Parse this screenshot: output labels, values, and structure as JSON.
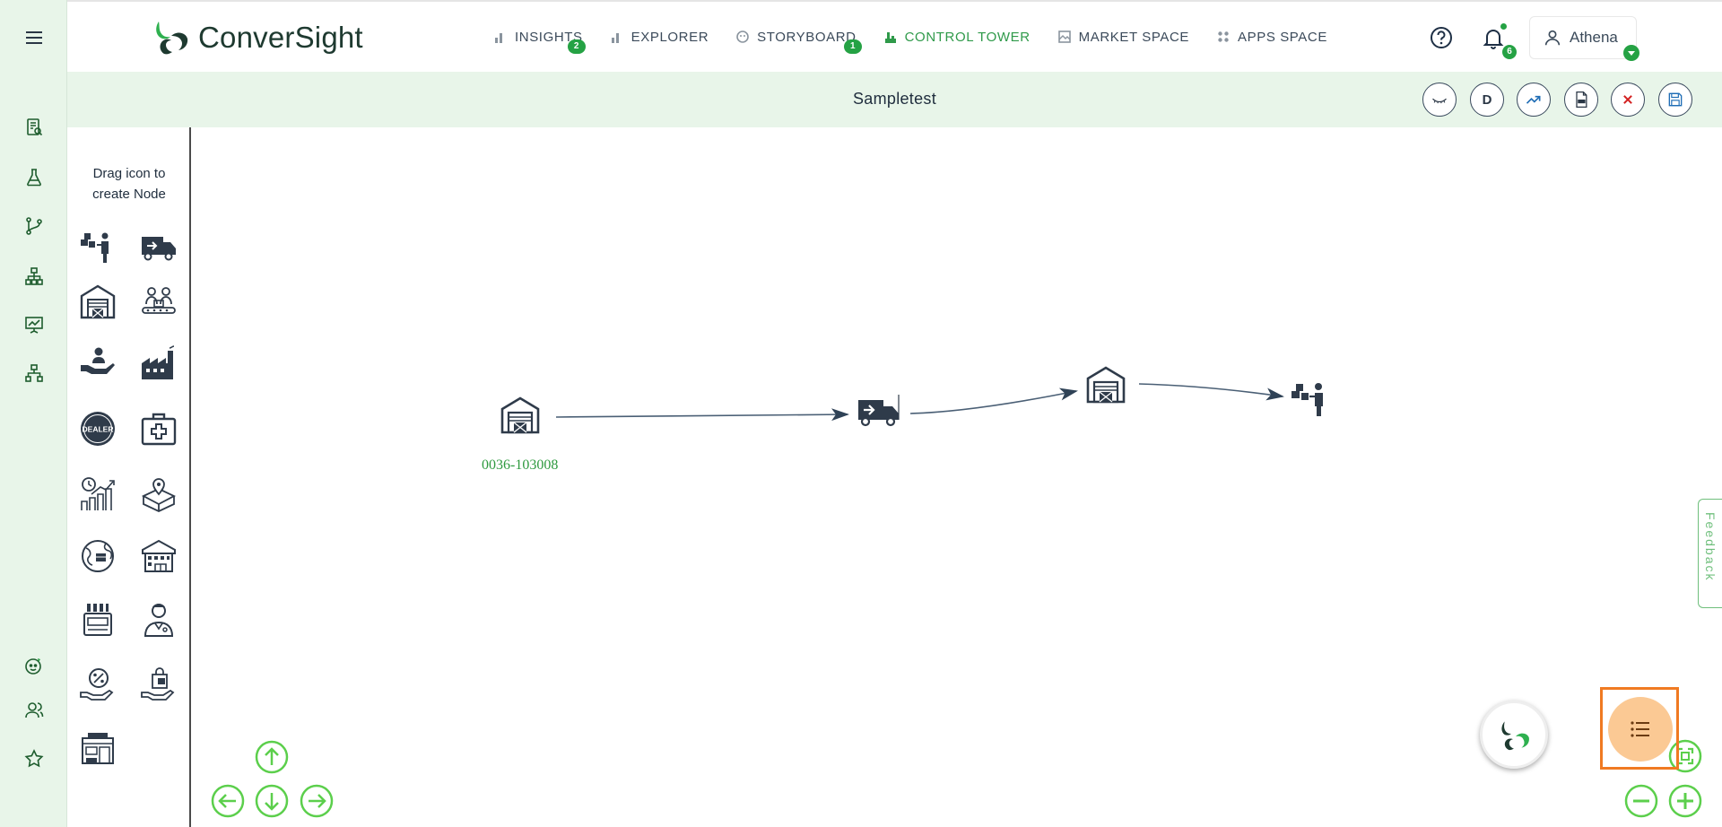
{
  "header": {
    "logo_text": "ConverSight",
    "nav": [
      {
        "label": "INSIGHTS",
        "badge": "2",
        "active": false
      },
      {
        "label": "EXPLORER",
        "badge": "",
        "active": false
      },
      {
        "label": "STORYBOARD",
        "badge": "1",
        "active": false
      },
      {
        "label": "CONTROL TOWER",
        "badge": "",
        "active": true
      },
      {
        "label": "MARKET SPACE",
        "badge": "",
        "active": false
      },
      {
        "label": "APPS SPACE",
        "badge": "",
        "active": false
      }
    ],
    "notifications_count": "6",
    "user_name": "Athena"
  },
  "toolbar": {
    "title": "Sampletest",
    "d_label": "D"
  },
  "palette": {
    "title_line1": "Drag icon to",
    "title_line2": "create Node",
    "icons": [
      "worker-boxes-icon",
      "delivery-truck-icon",
      "warehouse-icon",
      "conveyor-workers-icon",
      "care-hand-person-icon",
      "factory-icon",
      "dealer-icon",
      "first-aid-kit-icon",
      "clock-growth-chart-icon",
      "location-box-icon",
      "global-delivery-icon",
      "distribution-center-icon",
      "storage-rack-icon",
      "doctor-icon",
      "discount-hand-icon",
      "shopping-hand-icon",
      "storefront-icon"
    ],
    "dealer_text": "DEALER"
  },
  "canvas": {
    "node_label": "0036-103008"
  },
  "feedback_label": "Feedback",
  "colors": {
    "brand_green": "#25a244",
    "rail_bg": "#e8f5e9",
    "highlight_orange": "#f07a22",
    "icon_dark": "#2f3b4a"
  }
}
